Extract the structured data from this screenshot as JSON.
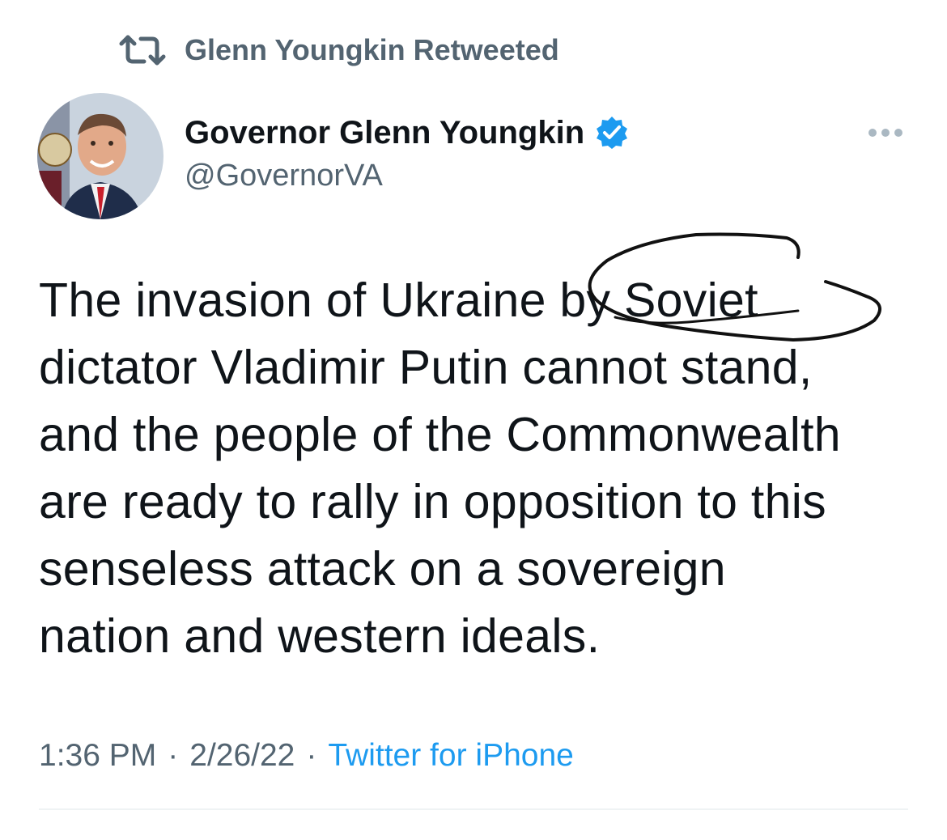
{
  "retweet": {
    "icon": "retweet-icon",
    "label": "Glenn Youngkin Retweeted"
  },
  "author": {
    "avatar_icon": "avatar",
    "display_name": "Governor Glenn Youngkin",
    "verified_icon": "verified-badge-icon",
    "handle": "@GovernorVA"
  },
  "more_icon": "more-options-icon",
  "tweet": {
    "lines": [
      "The invasion of Ukraine by Soviet",
      "dictator Vladimir Putin cannot stand,",
      "and the people of the Commonwealth",
      "are ready to rally in opposition to this",
      "senseless attack on a sovereign",
      "nation and western ideals."
    ]
  },
  "meta": {
    "time": "1:36 PM",
    "separator": "·",
    "date": "2/26/22",
    "source": "Twitter for iPhone"
  },
  "colors": {
    "text_primary": "#0f1419",
    "text_secondary": "#536471",
    "link_blue": "#1d9bf0",
    "divider": "#eff3f4",
    "annotation_ink": "#111111"
  }
}
